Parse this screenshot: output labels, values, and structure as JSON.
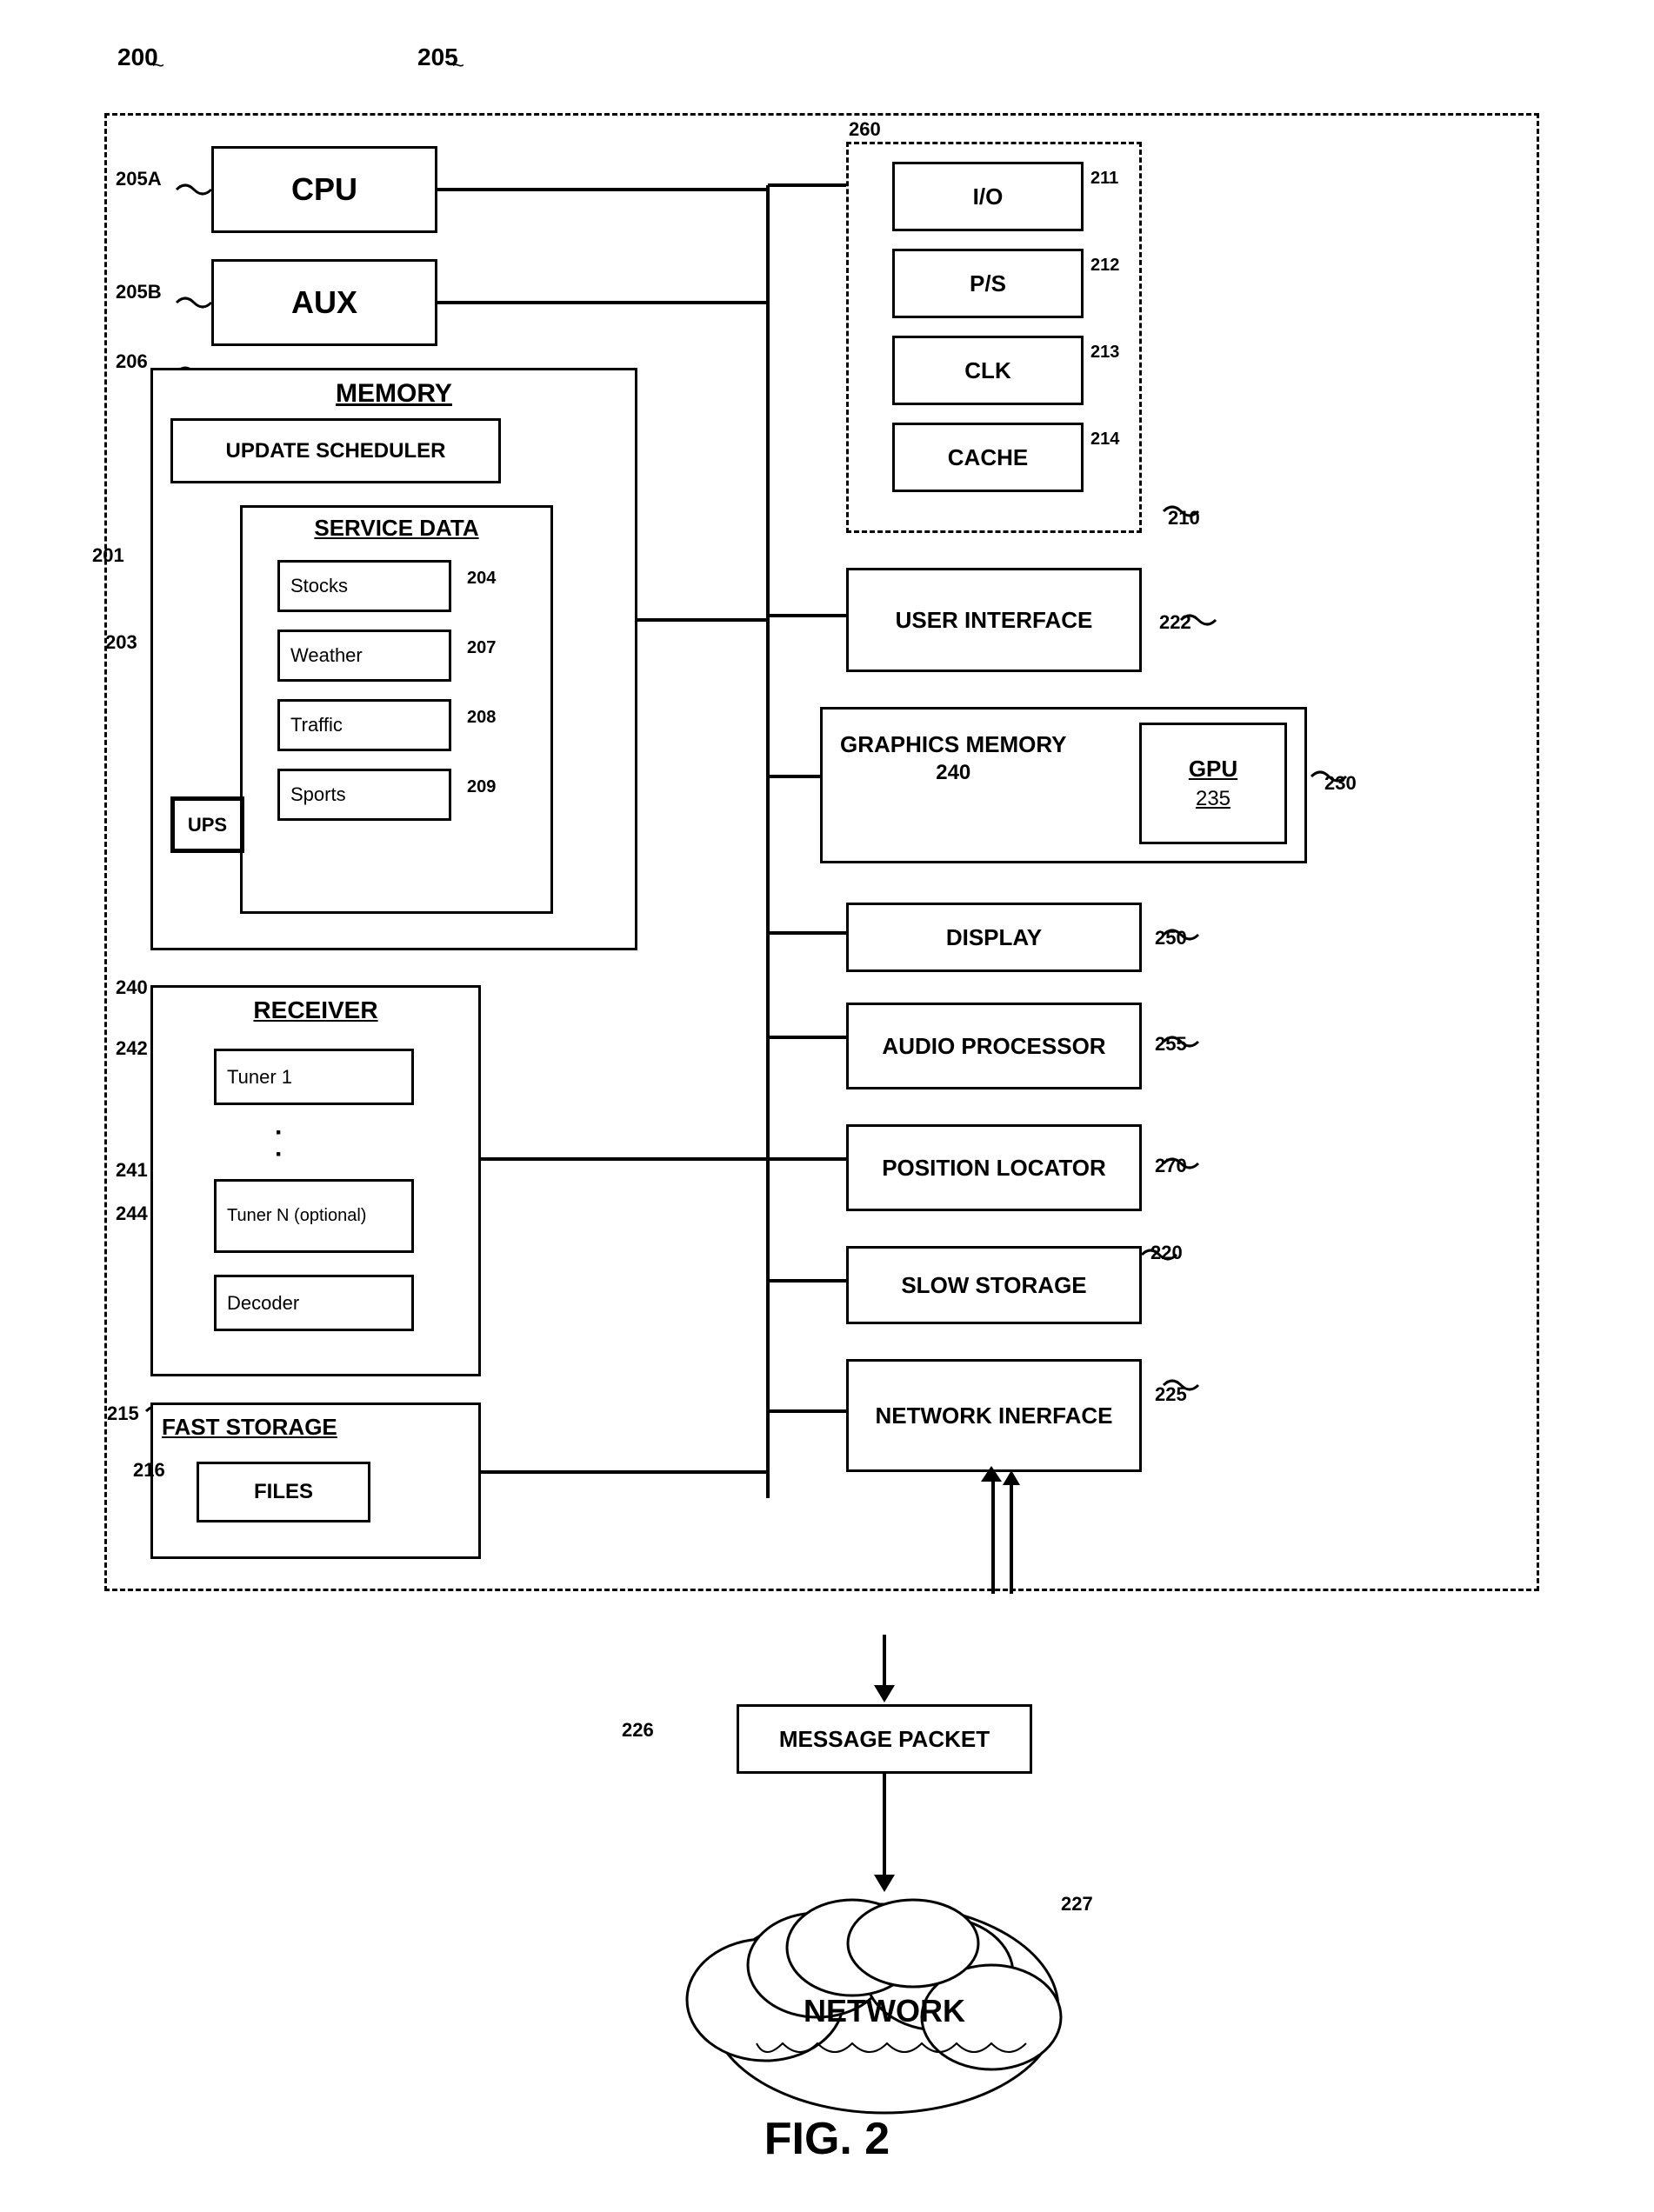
{
  "diagram": {
    "title": "FIG. 2",
    "labels": {
      "ref200": "200",
      "ref205": "205",
      "ref205A": "205A",
      "ref205B": "205B",
      "ref206": "206",
      "ref201": "201",
      "ref203": "203",
      "ref204": "204",
      "ref207": "207",
      "ref208": "208",
      "ref209": "209",
      "ref210": "210",
      "ref211": "211",
      "ref212": "212",
      "ref213": "213",
      "ref214": "214",
      "ref215": "215",
      "ref216": "216",
      "ref220": "220",
      "ref222": "222",
      "ref225": "225",
      "ref226": "226",
      "ref227": "227",
      "ref230": "230",
      "ref235": "235",
      "ref240_recv": "240",
      "ref240_gfx": "240",
      "ref241": "241",
      "ref242": "242",
      "ref244": "244",
      "ref250": "250",
      "ref255": "255",
      "ref260": "260",
      "ref270": "270"
    },
    "boxes": {
      "cpu": "CPU",
      "aux": "AUX",
      "memory": "MEMORY",
      "update_scheduler": "UPDATE SCHEDULER",
      "service_data": "SERVICE DATA",
      "stocks": "Stocks",
      "weather": "Weather",
      "traffic": "Traffic",
      "sports": "Sports",
      "ups": "UPS",
      "io": "I/O",
      "ps": "P/S",
      "clk": "CLK",
      "cache": "CACHE",
      "user_interface": "USER INTERFACE",
      "graphics_memory": "GRAPHICS MEMORY",
      "gfx_ref": "240",
      "gpu": "GPU",
      "gpu_ref": "235",
      "receiver": "RECEIVER",
      "tuner1": "Tuner 1",
      "tuner_dots": "·",
      "tunerN": "Tuner N (optional)",
      "decoder": "Decoder",
      "fast_storage": "FAST STORAGE",
      "files": "FILES",
      "display": "DISPLAY",
      "audio_processor": "AUDIO PROCESSOR",
      "position_locator": "POSITION LOCATOR",
      "slow_storage": "SLOW STORAGE",
      "network_interface": "NETWORK INERFACE",
      "message_packet": "MESSAGE PACKET",
      "network": "NETWORK"
    }
  }
}
